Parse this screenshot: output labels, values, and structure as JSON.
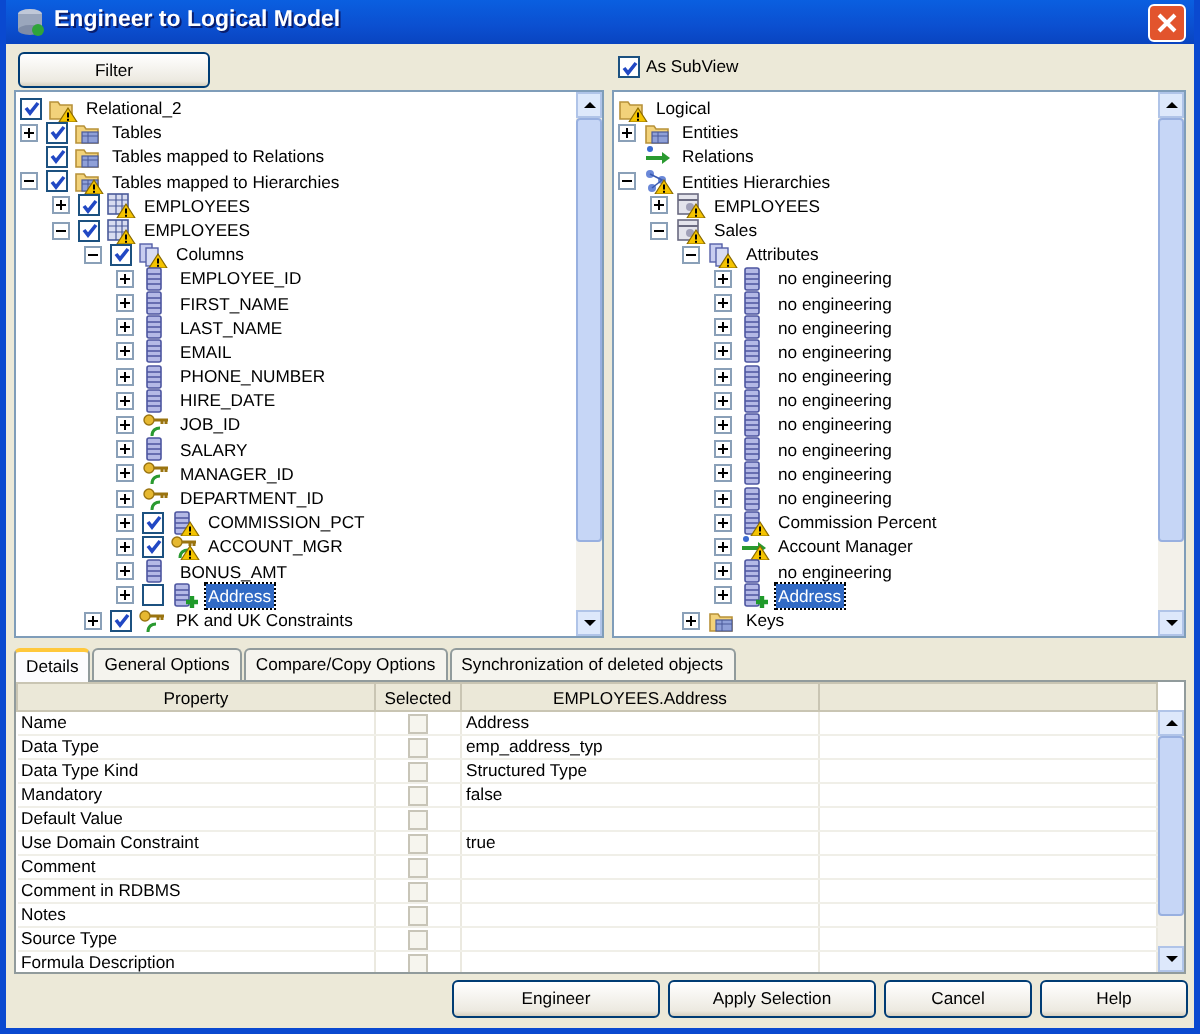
{
  "window": {
    "title": "Engineer to Logical Model"
  },
  "left_panel": {
    "filter_button": "Filter",
    "tree": [
      {
        "label": "Relational_2",
        "kind": "folder",
        "warning": true,
        "checked": true,
        "selected": false,
        "children": [
          {
            "label": "Tables",
            "kind": "table-folder",
            "warning": false,
            "checked": true,
            "expanded": false,
            "selected": false
          },
          {
            "label": "Tables mapped to Relations",
            "kind": "table-folder",
            "warning": false,
            "checked": true,
            "selected": false
          },
          {
            "label": "Tables mapped to Hierarchies",
            "kind": "table-folder",
            "warning": true,
            "checked": true,
            "expanded": true,
            "selected": false,
            "children": [
              {
                "label": "EMPLOYEES",
                "kind": "table",
                "warning": true,
                "checked": true,
                "expanded": false,
                "selected": false
              },
              {
                "label": "EMPLOYEES",
                "kind": "table",
                "warning": true,
                "checked": true,
                "expanded": true,
                "selected": false,
                "children": [
                  {
                    "label": "Columns",
                    "kind": "columns",
                    "warning": true,
                    "checked": true,
                    "expanded": true,
                    "selected": false,
                    "children": [
                      {
                        "label": "EMPLOYEE_ID",
                        "kind": "column",
                        "warning": false,
                        "expanded": false,
                        "selected": false
                      },
                      {
                        "label": "FIRST_NAME",
                        "kind": "column",
                        "warning": false,
                        "expanded": false,
                        "selected": false
                      },
                      {
                        "label": "LAST_NAME",
                        "kind": "column",
                        "warning": false,
                        "expanded": false,
                        "selected": false
                      },
                      {
                        "label": "EMAIL",
                        "kind": "column",
                        "warning": false,
                        "expanded": false,
                        "selected": false
                      },
                      {
                        "label": "PHONE_NUMBER",
                        "kind": "column",
                        "warning": false,
                        "expanded": false,
                        "selected": false
                      },
                      {
                        "label": "HIRE_DATE",
                        "kind": "column",
                        "warning": false,
                        "expanded": false,
                        "selected": false
                      },
                      {
                        "label": "JOB_ID",
                        "kind": "key",
                        "warning": false,
                        "expanded": false,
                        "selected": false
                      },
                      {
                        "label": "SALARY",
                        "kind": "column",
                        "warning": false,
                        "expanded": false,
                        "selected": false
                      },
                      {
                        "label": "MANAGER_ID",
                        "kind": "key",
                        "warning": false,
                        "expanded": false,
                        "selected": false
                      },
                      {
                        "label": "DEPARTMENT_ID",
                        "kind": "key",
                        "warning": false,
                        "expanded": false,
                        "selected": false
                      },
                      {
                        "label": "COMMISSION_PCT",
                        "kind": "column",
                        "warning": true,
                        "checked": true,
                        "expanded": false,
                        "selected": false
                      },
                      {
                        "label": "ACCOUNT_MGR",
                        "kind": "key",
                        "warning": true,
                        "checked": true,
                        "expanded": false,
                        "selected": false
                      },
                      {
                        "label": "BONUS_AMT",
                        "kind": "column",
                        "warning": false,
                        "expanded": false,
                        "selected": false
                      },
                      {
                        "label": "Address",
                        "kind": "column-added",
                        "warning": false,
                        "checked": false,
                        "expanded": false,
                        "selected": true
                      }
                    ]
                  },
                  {
                    "label": "PK and UK Constraints",
                    "kind": "key",
                    "warning": false,
                    "checked": true,
                    "expanded": false,
                    "selected": false
                  }
                ]
              }
            ]
          }
        ]
      }
    ]
  },
  "right_panel": {
    "subview_checkbox": {
      "label": "As SubView",
      "checked": true
    },
    "tree": [
      {
        "label": "Logical",
        "kind": "folder",
        "warning": true,
        "selected": false,
        "children": [
          {
            "label": "Entities",
            "kind": "table-folder",
            "warning": false,
            "expanded": false,
            "selected": false
          },
          {
            "label": "Relations",
            "kind": "relation",
            "warning": false,
            "selected": false
          },
          {
            "label": "Entities Hierarchies",
            "kind": "hierarchy",
            "warning": true,
            "expanded": true,
            "selected": false,
            "children": [
              {
                "label": "EMPLOYEES",
                "kind": "entity",
                "warning": true,
                "expanded": false,
                "selected": false
              },
              {
                "label": "Sales",
                "kind": "entity",
                "warning": true,
                "expanded": true,
                "selected": false,
                "children": [
                  {
                    "label": "Attributes",
                    "kind": "columns",
                    "warning": true,
                    "expanded": true,
                    "selected": false,
                    "children": [
                      {
                        "label": "no engineering",
                        "kind": "column",
                        "warning": false,
                        "expanded": false,
                        "selected": false
                      },
                      {
                        "label": "no engineering",
                        "kind": "column",
                        "warning": false,
                        "expanded": false,
                        "selected": false
                      },
                      {
                        "label": "no engineering",
                        "kind": "column",
                        "warning": false,
                        "expanded": false,
                        "selected": false
                      },
                      {
                        "label": "no engineering",
                        "kind": "column",
                        "warning": false,
                        "expanded": false,
                        "selected": false
                      },
                      {
                        "label": "no engineering",
                        "kind": "column",
                        "warning": false,
                        "expanded": false,
                        "selected": false
                      },
                      {
                        "label": "no engineering",
                        "kind": "column",
                        "warning": false,
                        "expanded": false,
                        "selected": false
                      },
                      {
                        "label": "no engineering",
                        "kind": "column",
                        "warning": false,
                        "expanded": false,
                        "selected": false
                      },
                      {
                        "label": "no engineering",
                        "kind": "column",
                        "warning": false,
                        "expanded": false,
                        "selected": false
                      },
                      {
                        "label": "no engineering",
                        "kind": "column",
                        "warning": false,
                        "expanded": false,
                        "selected": false
                      },
                      {
                        "label": "no engineering",
                        "kind": "column",
                        "warning": false,
                        "expanded": false,
                        "selected": false
                      },
                      {
                        "label": "Commission Percent",
                        "kind": "column",
                        "warning": true,
                        "expanded": false,
                        "selected": false
                      },
                      {
                        "label": "Account Manager",
                        "kind": "relation",
                        "warning": true,
                        "expanded": false,
                        "selected": false
                      },
                      {
                        "label": "no engineering",
                        "kind": "column",
                        "warning": false,
                        "expanded": false,
                        "selected": false
                      },
                      {
                        "label": "Address",
                        "kind": "column-added",
                        "warning": false,
                        "expanded": false,
                        "selected": true
                      }
                    ]
                  },
                  {
                    "label": "Keys",
                    "kind": "table-folder",
                    "warning": false,
                    "expanded": false,
                    "selected": false
                  }
                ]
              }
            ]
          }
        ]
      }
    ]
  },
  "tabs": [
    {
      "label": "Details",
      "selected": true
    },
    {
      "label": "General Options",
      "selected": false
    },
    {
      "label": "Compare/Copy Options",
      "selected": false
    },
    {
      "label": "Synchronization of deleted objects",
      "selected": false
    }
  ],
  "table": {
    "columns": [
      "Property",
      "Selected",
      "EMPLOYEES.Address"
    ],
    "rows": [
      {
        "property": "Name",
        "checked": false,
        "disabled": true,
        "value": "Address"
      },
      {
        "property": "Data Type",
        "checked": false,
        "disabled": true,
        "value": "emp_address_typ"
      },
      {
        "property": "Data Type Kind",
        "checked": false,
        "disabled": true,
        "value": "Structured Type"
      },
      {
        "property": "Mandatory",
        "checked": false,
        "disabled": true,
        "value": "false"
      },
      {
        "property": "Default Value",
        "checked": false,
        "disabled": true
      },
      {
        "property": "Use Domain Constraint",
        "checked": false,
        "disabled": true,
        "value": "true"
      },
      {
        "property": "Comment",
        "checked": false,
        "disabled": true
      },
      {
        "property": "Comment in RDBMS",
        "checked": false,
        "disabled": true
      },
      {
        "property": "Notes",
        "checked": false,
        "disabled": true
      },
      {
        "property": "Source Type",
        "checked": false,
        "disabled": true
      },
      {
        "property": "Formula Description",
        "checked": false,
        "disabled": true
      }
    ]
  },
  "buttons": [
    "Engineer",
    "Apply Selection",
    "Cancel",
    "Help"
  ]
}
